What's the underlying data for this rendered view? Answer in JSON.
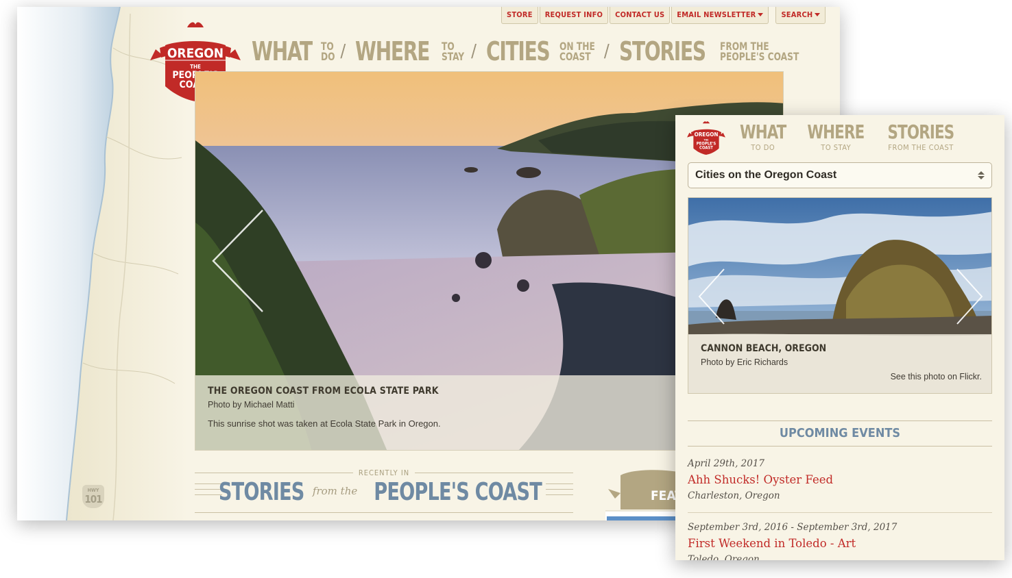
{
  "desktop": {
    "utility_nav": [
      {
        "label": "STORE"
      },
      {
        "label": "REQUEST INFO"
      },
      {
        "label": "CONTACT US"
      },
      {
        "label": "EMAIL NEWSLETTER",
        "dropdown": true
      },
      {
        "label": "SEARCH",
        "dropdown": true
      }
    ],
    "logo": {
      "line1": "OREGON",
      "line2": "THE",
      "line3": "PEOPLE'S",
      "line4": "COAST"
    },
    "main_nav": [
      {
        "big": "WHAT",
        "small1": "TO",
        "small2": "DO"
      },
      {
        "big": "WHERE",
        "small1": "TO",
        "small2": "STAY"
      },
      {
        "big": "CITIES",
        "small1": "ON THE",
        "small2": "COAST"
      },
      {
        "big": "STORIES",
        "small1": "FROM THE",
        "small2": "PEOPLE'S COAST"
      }
    ],
    "nav_separator": "/",
    "hero": {
      "title": "THE OREGON COAST FROM ECOLA STATE PARK",
      "credit": "Photo by Michael Matti",
      "description": "This sunrise shot was taken at Ecola State Park in Oregon."
    },
    "stories": {
      "eyebrow": "RECENTLY IN",
      "left": "STORIES",
      "connector": "from the",
      "right": "PEOPLE'S COAST"
    },
    "featured_tab": "FEAT",
    "highway_shield": {
      "label": "HWY",
      "number": "101"
    }
  },
  "mobile": {
    "nav": [
      {
        "big": "WHAT",
        "small": "TO DO"
      },
      {
        "big": "WHERE",
        "small": "TO STAY"
      },
      {
        "big": "STORIES",
        "small": "FROM THE COAST"
      }
    ],
    "select_value": "Cities on the Oregon Coast",
    "hero": {
      "title": "CANNON BEACH, OREGON",
      "credit": "Photo by Eric Richards",
      "link": "See this photo on Flickr."
    },
    "events_heading": "UPCOMING EVENTS",
    "events": [
      {
        "date": "April 29th, 2017",
        "title": "Ahh Shucks! Oyster Feed",
        "location": "Charleston, Oregon"
      },
      {
        "date": "September 3rd, 2016 - September 3rd, 2017",
        "title": "First Weekend in Toledo - Art",
        "location": "Toledo, Oregon"
      }
    ]
  },
  "colors": {
    "brand_red": "#c12a27",
    "nav_tan": "#b3a682",
    "heading_blue": "#6f8aa3",
    "background_cream": "#f8f4e6"
  },
  "icons": [
    "chevron-left-icon",
    "chevron-right-icon",
    "caret-down-icon",
    "select-arrows-icon",
    "highway-shield-icon"
  ]
}
